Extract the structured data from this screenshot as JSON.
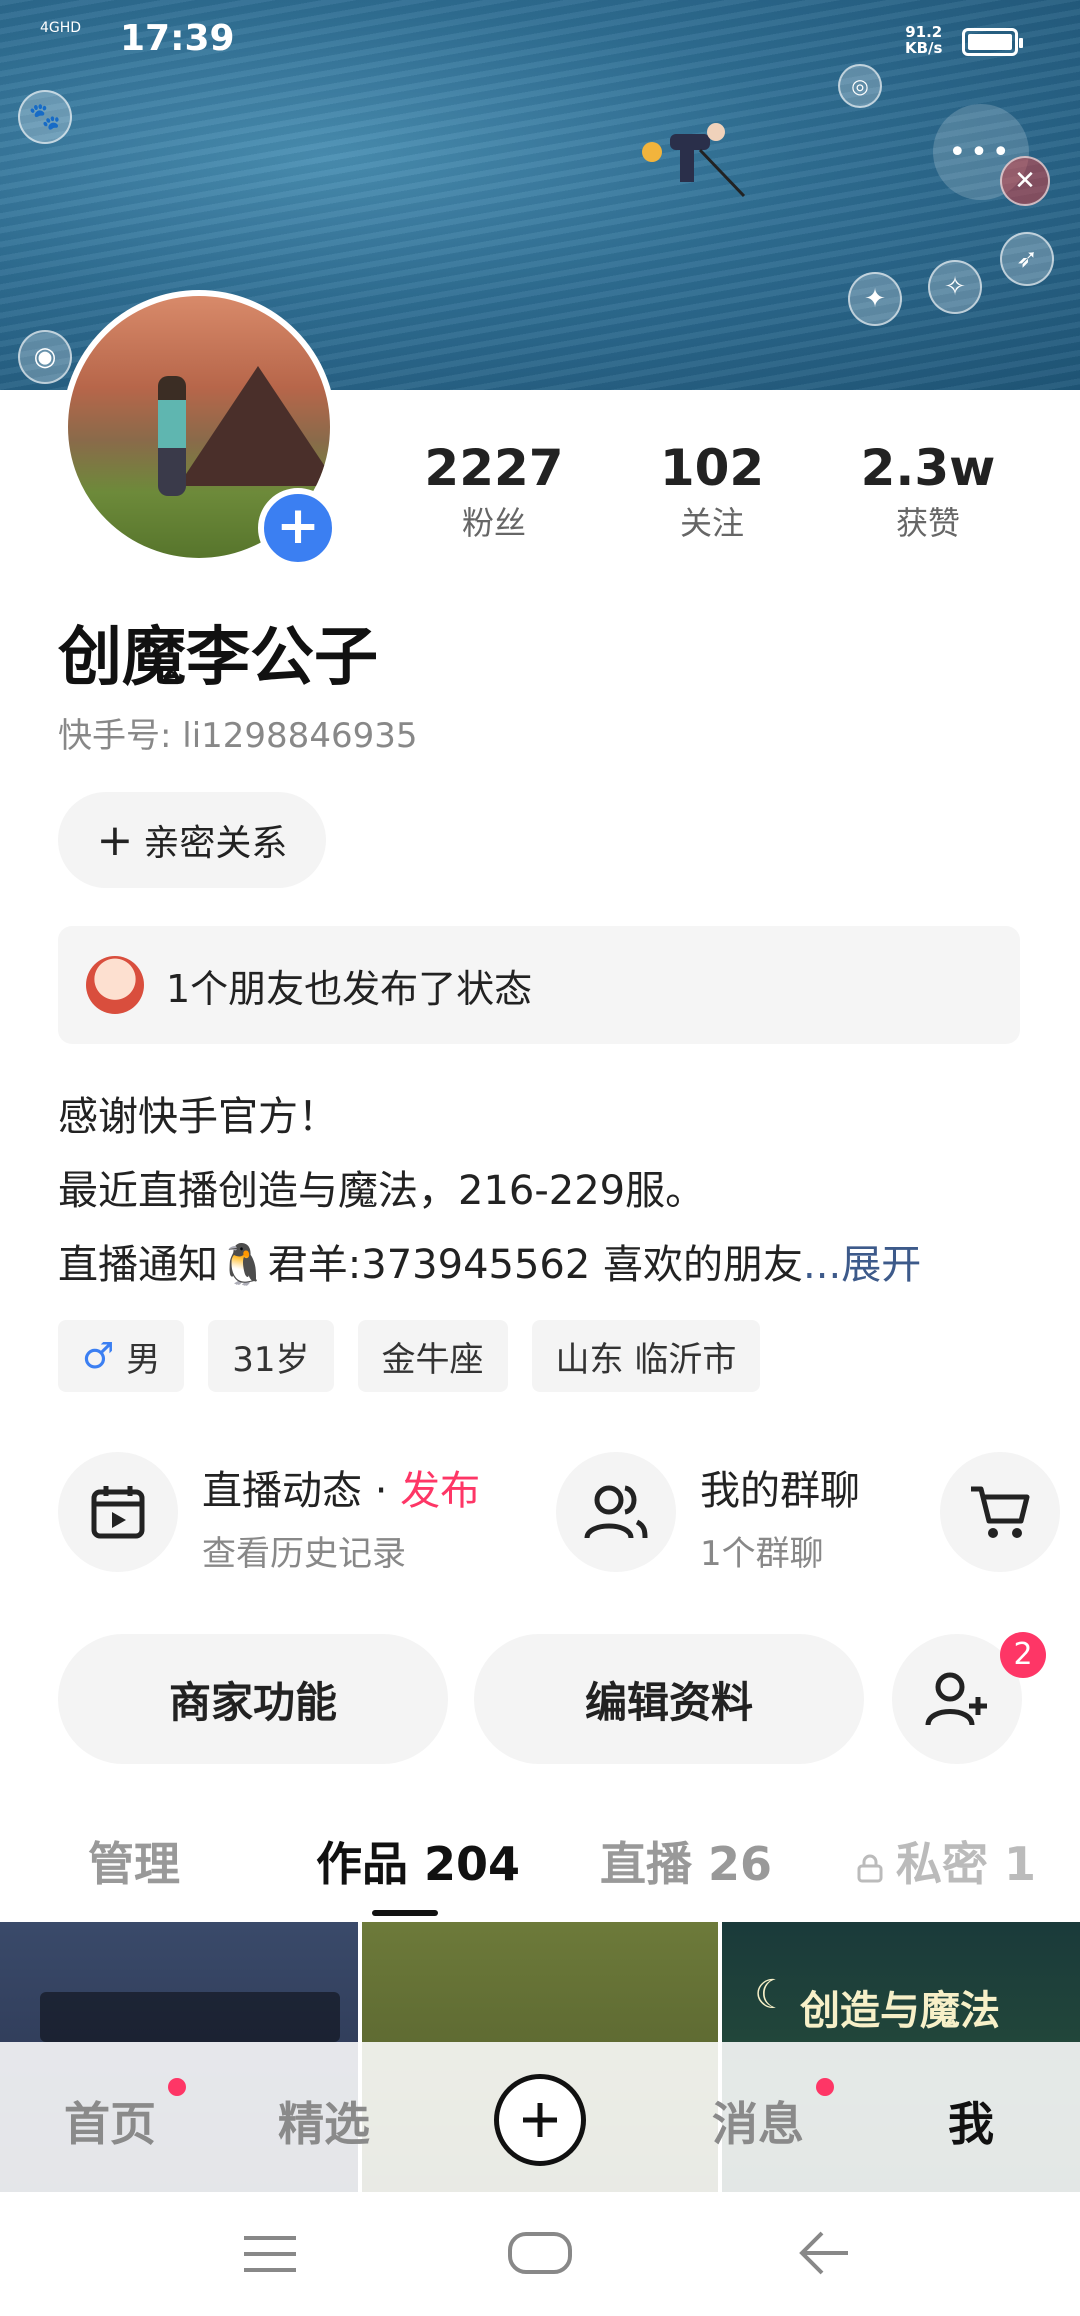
{
  "status_bar": {
    "time": "17:39",
    "network": "4GHD",
    "speed": "91.2",
    "speed_unit": "KB/s"
  },
  "profile": {
    "name": "创魔李公子",
    "kuaishou_id": "快手号: li1298846935",
    "stats": [
      {
        "value": "2227",
        "label": "粉丝"
      },
      {
        "value": "102",
        "label": "关注"
      },
      {
        "value": "2.3w",
        "label": "获赞"
      }
    ],
    "intimate_label": "亲密关系",
    "friend_status": "1个朋友也发布了状态",
    "bio_lines": [
      "感谢快手官方！",
      "最近直播创造与魔法，216-229服。",
      "直播通知🐧君羊:373945562 喜欢的朋友"
    ],
    "bio_more": "...展开",
    "tags": [
      "男",
      "31岁",
      "金牛座",
      "山东 临沂市"
    ]
  },
  "features": {
    "live_title": "直播动态 · ",
    "live_publish": "发布",
    "live_sub": "查看历史记录",
    "group_title": "我的群聊",
    "group_sub": "1个群聊"
  },
  "actions": {
    "merchant": "商家功能",
    "edit_profile": "编辑资料",
    "follow_badge": "2"
  },
  "tabs": [
    {
      "label": "管理"
    },
    {
      "label": "作品 204"
    },
    {
      "label": "直播 26"
    },
    {
      "label": "私密 1"
    }
  ],
  "thumbnails": {
    "third_title": "创造与魔法"
  },
  "bottom_nav": [
    "首页",
    "精选",
    "消息",
    "我"
  ],
  "colors": {
    "accent_blue": "#3b7ff2",
    "accent_red": "#fe3666"
  }
}
